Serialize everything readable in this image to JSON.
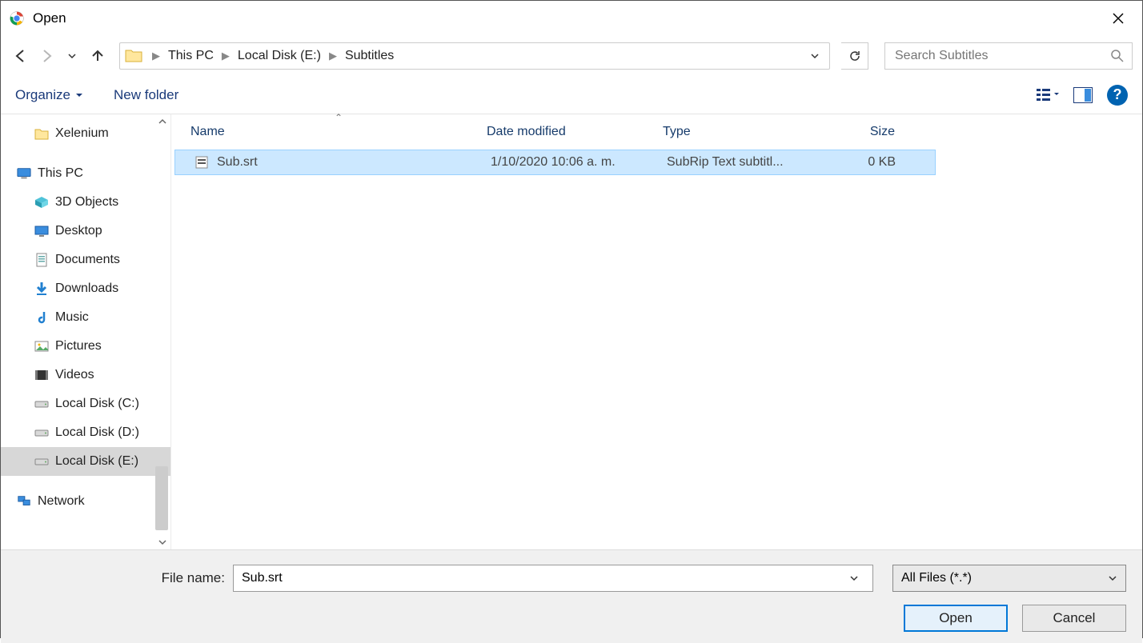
{
  "window": {
    "title": "Open"
  },
  "breadcrumb": [
    "This PC",
    "Local Disk (E:)",
    "Subtitles"
  ],
  "search": {
    "placeholder": "Search Subtitles"
  },
  "toolbar": {
    "organize": "Organize",
    "newfolder": "New folder"
  },
  "sidebar": {
    "quick": "Xelenium",
    "thispc": "This PC",
    "items": [
      {
        "label": "3D Objects",
        "icon": "cube"
      },
      {
        "label": "Desktop",
        "icon": "desktop"
      },
      {
        "label": "Documents",
        "icon": "doc"
      },
      {
        "label": "Downloads",
        "icon": "download"
      },
      {
        "label": "Music",
        "icon": "music"
      },
      {
        "label": "Pictures",
        "icon": "picture"
      },
      {
        "label": "Videos",
        "icon": "video"
      },
      {
        "label": "Local Disk (C:)",
        "icon": "drive"
      },
      {
        "label": "Local Disk (D:)",
        "icon": "drive"
      },
      {
        "label": "Local Disk (E:)",
        "icon": "drive",
        "selected": true
      }
    ],
    "network": "Network"
  },
  "columns": {
    "name": "Name",
    "date": "Date modified",
    "type": "Type",
    "size": "Size"
  },
  "files": [
    {
      "name": "Sub.srt",
      "date": "1/10/2020 10:06 a. m.",
      "type": "SubRip Text subtitl...",
      "size": "0 KB"
    }
  ],
  "footer": {
    "fnlabel": "File name:",
    "fnvalue": "Sub.srt",
    "filter": "All Files (*.*)",
    "open": "Open",
    "cancel": "Cancel"
  }
}
